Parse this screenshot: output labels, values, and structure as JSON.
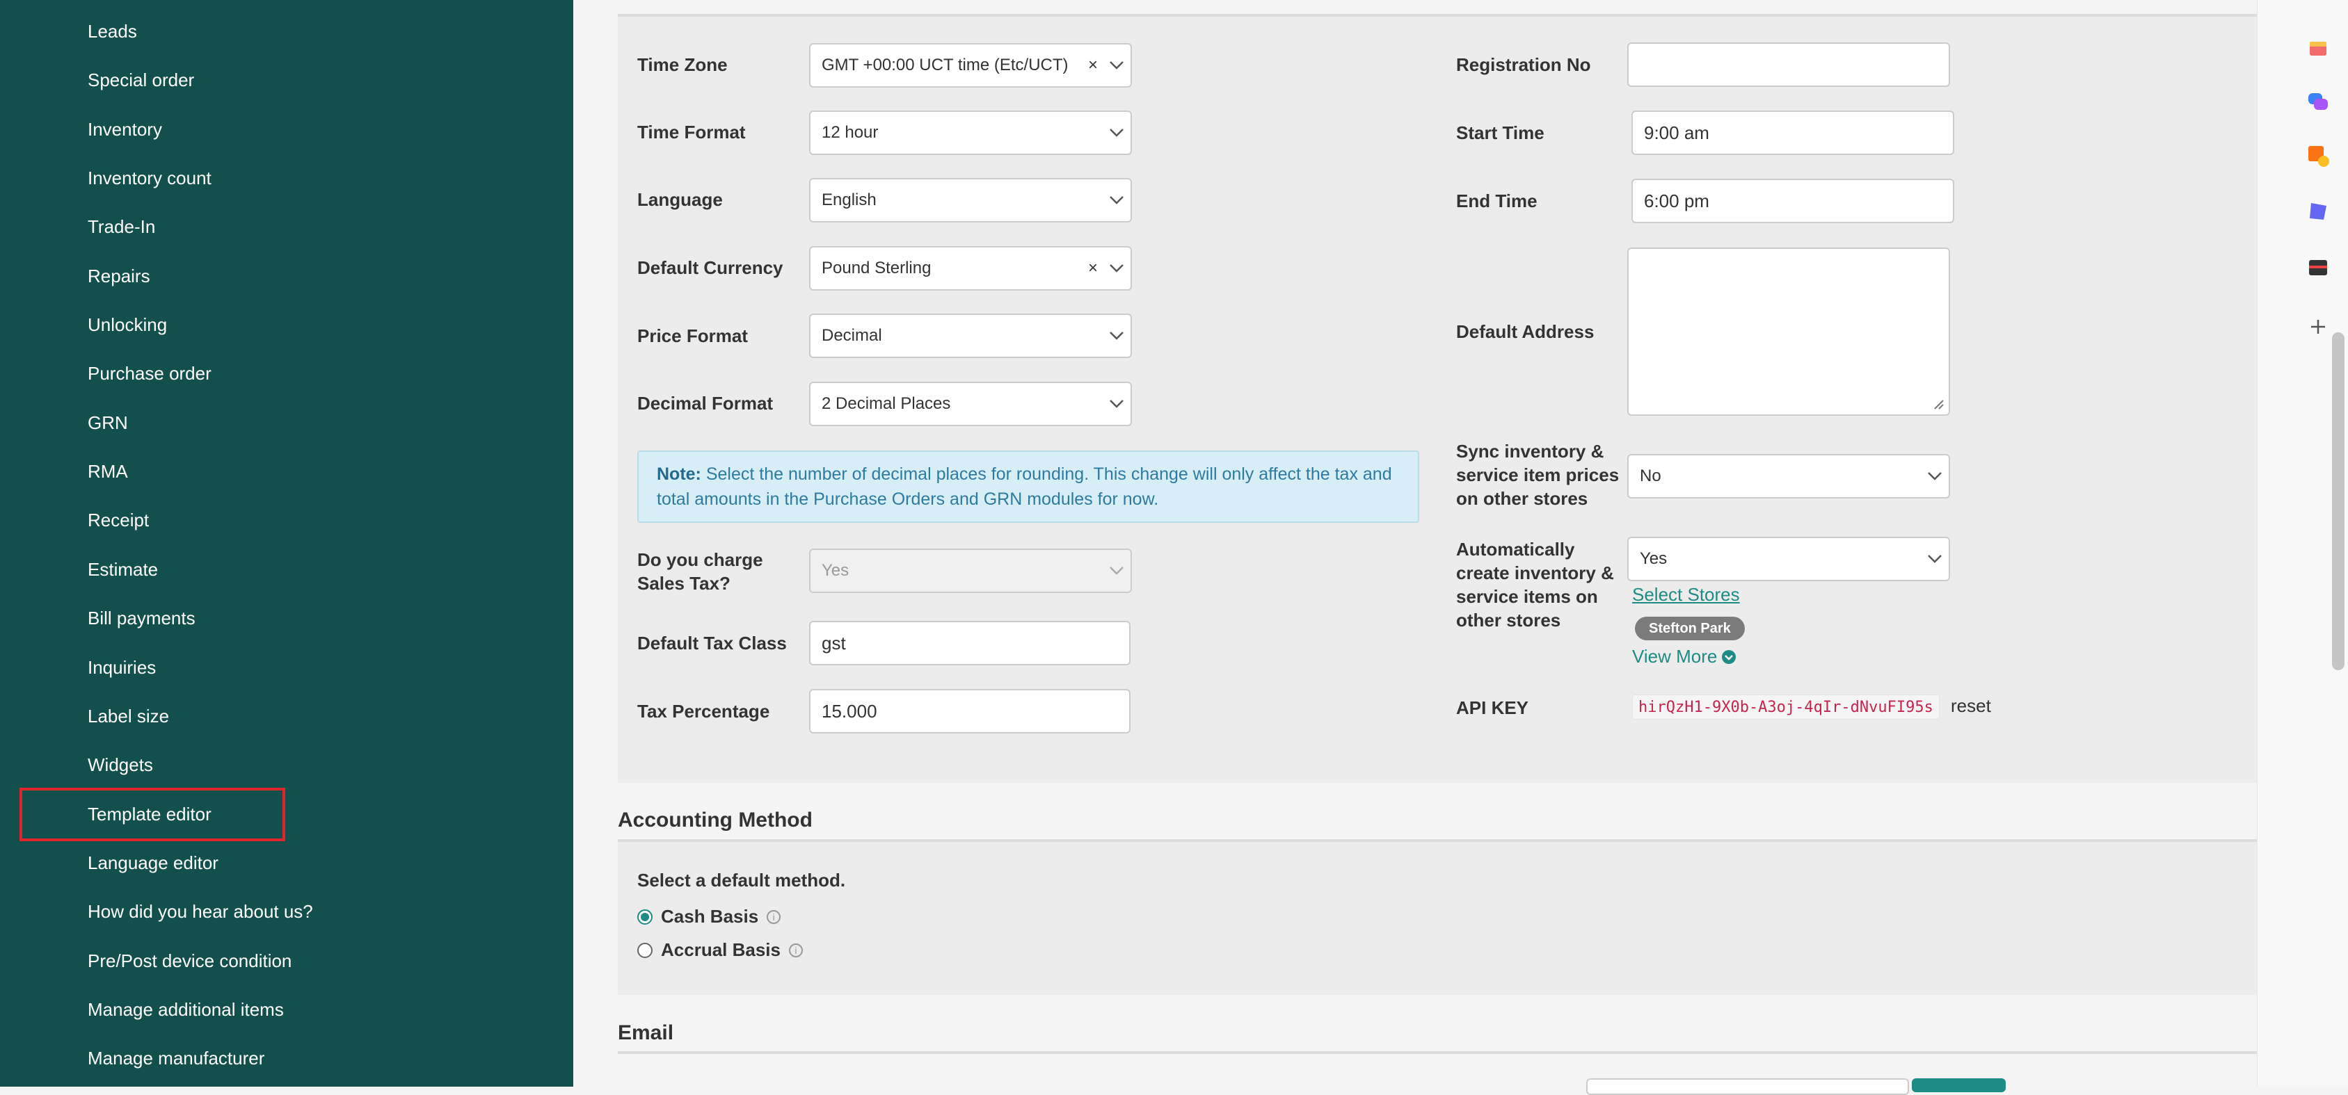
{
  "sidebar": {
    "items": [
      "Leads",
      "Special order",
      "Inventory",
      "Inventory count",
      "Trade-In",
      "Repairs",
      "Unlocking",
      "Purchase order",
      "GRN",
      "RMA",
      "Receipt",
      "Estimate",
      "Bill payments",
      "Inquiries",
      "Label size",
      "Widgets",
      "Template editor",
      "Language editor",
      "How did you hear about us?",
      "Pre/Post device condition",
      "Manage additional items",
      "Manage manufacturer"
    ],
    "highlighted_item": "Template editor"
  },
  "other_info": {
    "time_zone": {
      "label": "Time Zone",
      "value": "GMT +00:00 UCT time (Etc/UCT)"
    },
    "time_format": {
      "label": "Time Format",
      "value": "12 hour"
    },
    "language": {
      "label": "Language",
      "value": "English"
    },
    "default_currency": {
      "label": "Default Currency",
      "value": "Pound Sterling"
    },
    "price_format": {
      "label": "Price Format",
      "value": "Decimal"
    },
    "decimal_format": {
      "label": "Decimal Format",
      "value": "2 Decimal Places"
    },
    "note": {
      "prefix": "Note:",
      "text": "Select the number of decimal places for rounding. This change will only affect the tax and total amounts in the Purchase Orders and GRN modules for now."
    },
    "charge_sales_tax": {
      "label": "Do you charge Sales Tax?",
      "value": "Yes"
    },
    "default_tax_class": {
      "label": "Default Tax Class",
      "value": "gst"
    },
    "tax_percentage": {
      "label": "Tax Percentage",
      "value": "15.000"
    },
    "registration_no": {
      "label": "Registration No",
      "value": ""
    },
    "start_time": {
      "label": "Start Time",
      "value": "9:00 am"
    },
    "end_time": {
      "label": "End Time",
      "value": "6:00 pm"
    },
    "default_address": {
      "label": "Default Address",
      "value": ""
    },
    "sync_inventory": {
      "label": "Sync inventory & service item prices on other stores",
      "value": "No"
    },
    "auto_create": {
      "label": "Automatically create inventory & service items on other stores",
      "value": "Yes"
    },
    "select_stores_link": "Select Stores",
    "store_badge": "Stefton Park",
    "view_more": "View More",
    "api_key": {
      "label": "API KEY",
      "value": "hirQzH1-9X0b-A3oj-4qIr-dNvuFI95s",
      "reset": "reset"
    }
  },
  "accounting": {
    "title": "Accounting Method",
    "subtitle": "Select a default method.",
    "options": [
      "Cash Basis",
      "Accrual Basis"
    ],
    "selected": "Cash Basis"
  },
  "email": {
    "title": "Email"
  },
  "colors": {
    "sidebar_bg": "#134f4c",
    "accent": "#1e8b86",
    "highlight_border": "#e0262b",
    "api_key_text": "#c7254e"
  }
}
